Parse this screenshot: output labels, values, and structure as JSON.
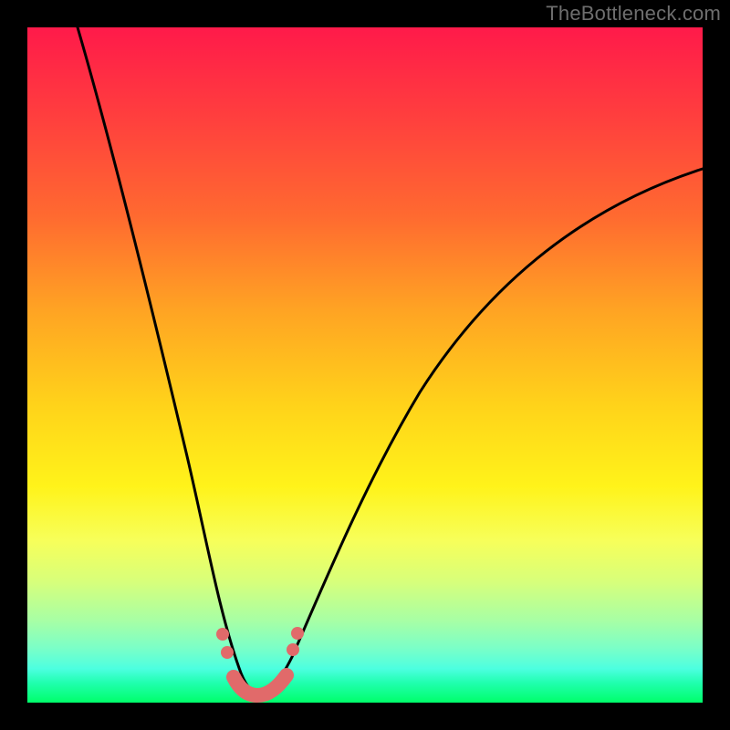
{
  "watermark": "TheBottleneck.com",
  "chart_data": {
    "type": "line",
    "title": "",
    "xlabel": "",
    "ylabel": "",
    "xlim": [
      0,
      1
    ],
    "ylim": [
      0,
      100
    ],
    "x": [
      0.0,
      0.05,
      0.1,
      0.15,
      0.2,
      0.25,
      0.275,
      0.3,
      0.325,
      0.333,
      0.36,
      0.4,
      0.45,
      0.5,
      0.55,
      0.6,
      0.65,
      0.7,
      0.75,
      0.8,
      0.85,
      0.9,
      0.95,
      1.0
    ],
    "values": [
      100,
      90,
      75,
      58,
      40,
      20,
      10,
      3,
      0,
      0,
      2,
      8,
      17,
      27,
      36,
      44,
      51,
      57,
      62,
      67,
      71,
      74,
      77,
      79
    ],
    "background_gradient": {
      "top": "#ff1a4a",
      "middle": "#ffe31a",
      "bottom": "#00ff6a"
    },
    "annotations": {
      "minimum_marker_color": "#e16a6a",
      "minimum_x_range": [
        0.275,
        0.38
      ]
    }
  }
}
